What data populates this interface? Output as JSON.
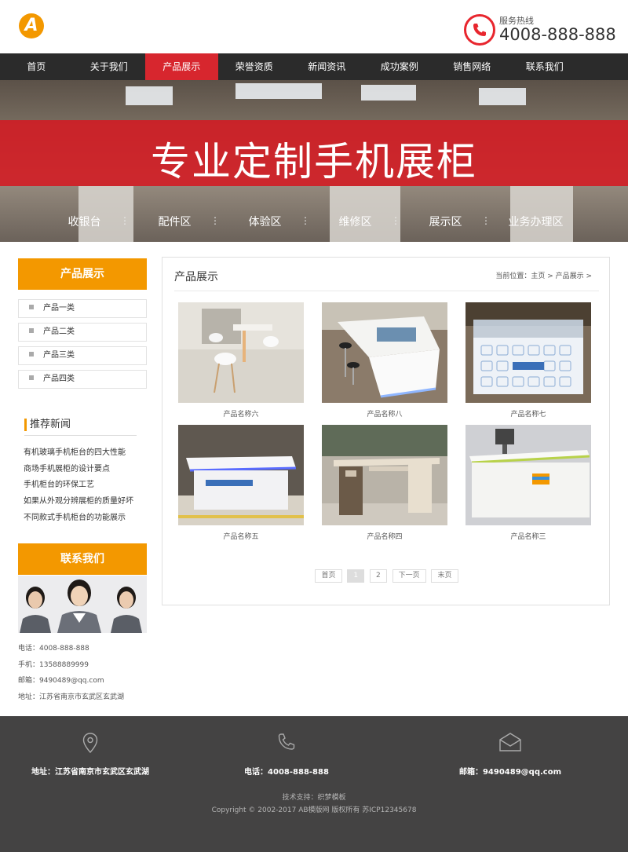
{
  "header": {
    "logo_letter": "A",
    "hotline_label": "服务热线",
    "hotline_number": "4008-888-888"
  },
  "nav": {
    "items": [
      {
        "label": "首页"
      },
      {
        "label": "关于我们"
      },
      {
        "label": "产品展示",
        "active": true
      },
      {
        "label": "荣誉资质"
      },
      {
        "label": "新闻资讯"
      },
      {
        "label": "成功案例"
      },
      {
        "label": "销售网络"
      },
      {
        "label": "联系我们"
      }
    ]
  },
  "banner": {
    "title": "专业定制手机展柜",
    "labels": [
      "收银台",
      "配件区",
      "体验区",
      "维修区",
      "展示区",
      "业务办理区"
    ]
  },
  "sidebar": {
    "products_title": "产品展示",
    "categories": [
      "产品一类",
      "产品二类",
      "产品三类",
      "产品四类"
    ],
    "news_title": "推荐新闻",
    "news": [
      "有机玻璃手机柜台的四大性能",
      "商场手机展柜的设计要点",
      "手机柜台的环保工艺",
      "如果从外观分辨展柜的质量好坏",
      "不同款式手机柜台的功能展示"
    ],
    "contact_title": "联系我们",
    "contact": {
      "phone": "电话：4008-888-888",
      "mobile": "手机：13588889999",
      "email": "邮箱：9490489@qq.com",
      "address": "地址：江苏省南京市玄武区玄武湖"
    }
  },
  "main": {
    "title": "产品展示",
    "breadcrumb": "当前位置：主页 > 产品展示 >",
    "products": [
      {
        "name": "产品名称六"
      },
      {
        "name": "产品名称八"
      },
      {
        "name": "产品名称七"
      },
      {
        "name": "产品名称五"
      },
      {
        "name": "产品名称四"
      },
      {
        "name": "产品名称三"
      }
    ],
    "pager": {
      "first": "首页",
      "page1": "1",
      "page2": "2",
      "next": "下一页",
      "last": "末页"
    }
  },
  "footer": {
    "address": "地址：江苏省南京市玄武区玄武湖",
    "phone": "电话：4008-888-888",
    "email": "邮箱：9490489@qq.com",
    "tech": "技术支持：织梦模板",
    "copyright": "Copyright © 2002-2017 AB模版网 版权所有   苏ICP12345678"
  },
  "colors": {
    "accent_orange": "#f39800",
    "nav_dark": "#2b2b2b",
    "active_red": "#d7262e",
    "footer_bg": "#444343"
  },
  "icons": [
    "logo-icon",
    "phone-icon",
    "location-icon",
    "phone-handset-icon",
    "mail-icon"
  ]
}
